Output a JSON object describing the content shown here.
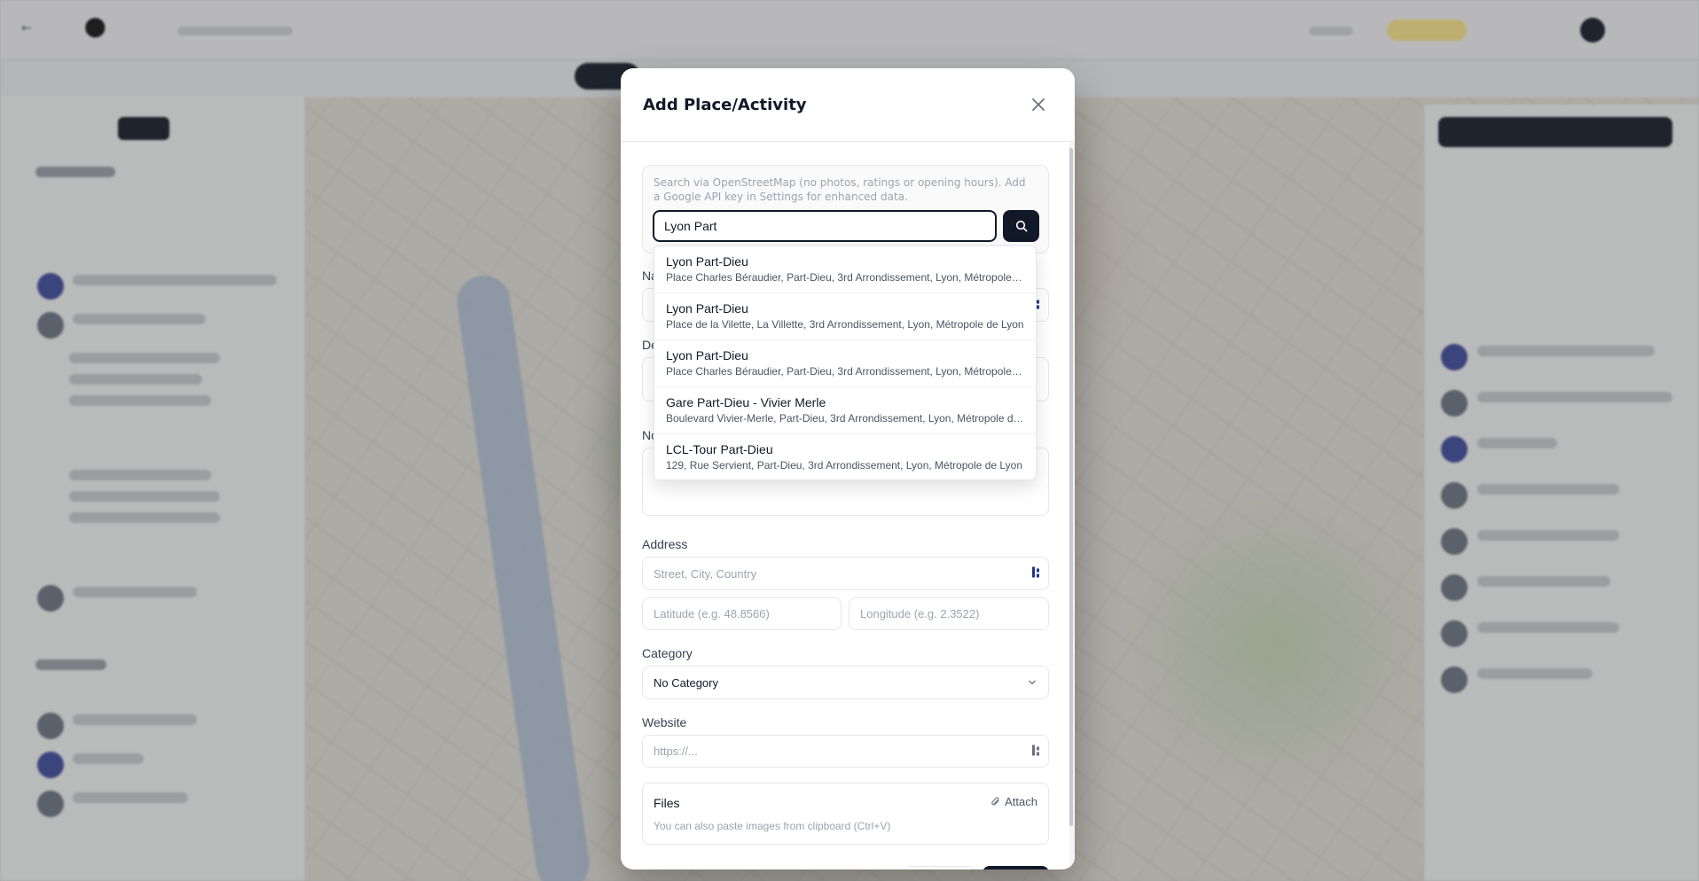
{
  "modal": {
    "title": "Add Place/Activity",
    "osm_hint": "Search via OpenStreetMap (no photos, ratings or opening hours). Add a Google API key in Settings for enhanced data.",
    "search_value": "Lyon Part",
    "labels": {
      "name_partial": "Na",
      "description_partial": "De",
      "notes_partial": "No",
      "address": "Address",
      "category": "Category",
      "website": "Website"
    },
    "placeholders": {
      "address": "Street, City, Country",
      "latitude": "Latitude (e.g. 48.8566)",
      "longitude": "Longitude (e.g. 2.3522)",
      "website": "https://..."
    },
    "category_value": "No Category",
    "files": {
      "title": "Files",
      "attach_label": "Attach",
      "hint": "You can also paste images from clipboard (Ctrl+V)"
    }
  },
  "suggestions": [
    {
      "name": "Lyon Part-Dieu",
      "address": "Place Charles Béraudier, Part-Dieu, 3rd Arrondissement, Lyon, Métropole de Lyon"
    },
    {
      "name": "Lyon Part-Dieu",
      "address": "Place de la Vilette, La Villette, 3rd Arrondissement, Lyon, Métropole de Lyon"
    },
    {
      "name": "Lyon Part-Dieu",
      "address": "Place Charles Béraudier, Part-Dieu, 3rd Arrondissement, Lyon, Métropole de Lyon"
    },
    {
      "name": "Gare Part-Dieu - Vivier Merle",
      "address": "Boulevard Vivier-Merle, Part-Dieu, 3rd Arrondissement, Lyon, Métropole de Lyon"
    },
    {
      "name": "LCL-Tour Part-Dieu",
      "address": "129, Rue Servient, Part-Dieu, 3rd Arrondissement, Lyon, Métropole de Lyon"
    }
  ],
  "colors": {
    "primary": "#111827",
    "border": "#e5e7eb",
    "muted": "#9ca3af"
  }
}
